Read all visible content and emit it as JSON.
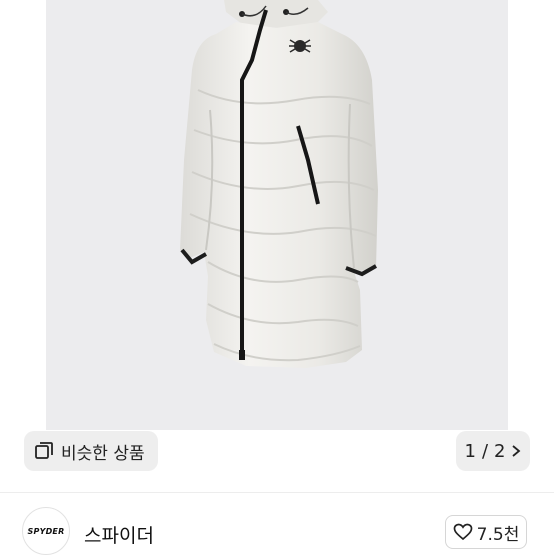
{
  "viewer": {
    "similar_label": "비슷한 상품",
    "page_current": "1",
    "page_separator": "/",
    "page_total": "2"
  },
  "seller": {
    "logo_text": "SPYDER",
    "name": "스파이더"
  },
  "like": {
    "count": "7.5천"
  },
  "icons": {
    "similar": "gallery-icon",
    "next": "chevron-right-icon",
    "like": "heart-icon"
  }
}
